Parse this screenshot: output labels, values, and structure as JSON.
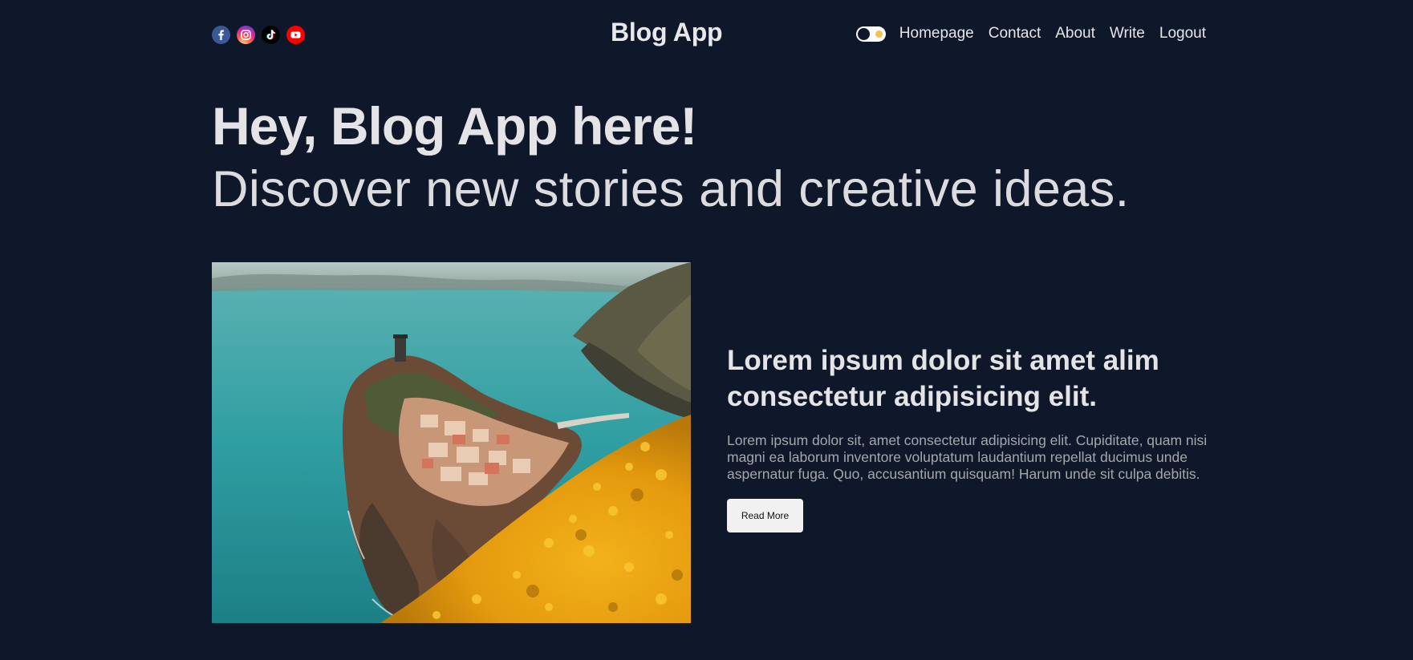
{
  "colors": {
    "background": "#0f172a",
    "text": "#e4e4e6",
    "muted_text": "#a4a7ae",
    "button_bg": "#f1f1f1",
    "facebook": "#3b5998",
    "tiktok": "#000000",
    "youtube": "#ff0000",
    "toggle_sun": "#f2c14e"
  },
  "navbar": {
    "social_icons": [
      "facebook-icon",
      "instagram-icon",
      "tiktok-icon",
      "youtube-icon"
    ],
    "brand": "Blog App",
    "theme_toggle": "dark-mode-toggle",
    "links": [
      "Homepage",
      "Contact",
      "About",
      "Write",
      "Logout"
    ]
  },
  "hero": {
    "title": "Hey, Blog App here!",
    "subtitle": "Discover new stories and creative ideas."
  },
  "featured_post": {
    "image": "coastal-village-photo",
    "title": "Lorem ipsum dolor sit amet alim consectetur adipisicing elit.",
    "excerpt": "Lorem ipsum dolor sit, amet consectetur adipisicing elit. Cupiditate, quam nisi magni ea laborum inventore voluptatum laudantium repellat ducimus unde aspernatur fuga. Quo, accusantium quisquam! Harum unde sit culpa debitis.",
    "button_label": "Read More"
  }
}
